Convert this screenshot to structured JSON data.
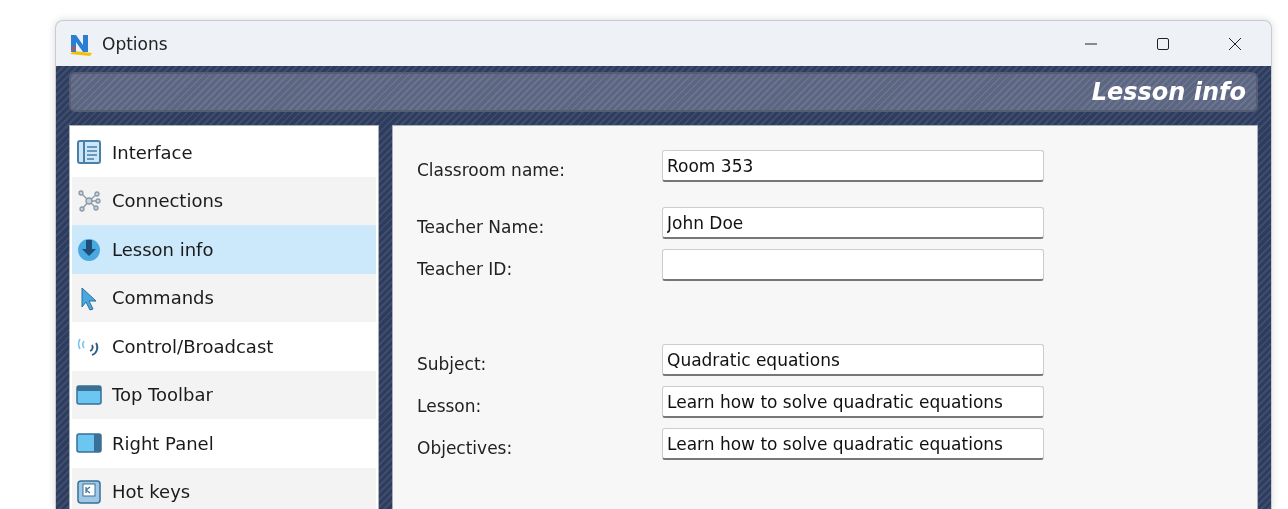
{
  "window": {
    "title": "Options"
  },
  "header": {
    "title": "Lesson info"
  },
  "sidebar": {
    "items": [
      {
        "label": "Interface",
        "kind": "interface",
        "selected": false
      },
      {
        "label": "Connections",
        "kind": "connections",
        "selected": false
      },
      {
        "label": "Lesson info",
        "kind": "lesson",
        "selected": true
      },
      {
        "label": "Commands",
        "kind": "commands",
        "selected": false
      },
      {
        "label": "Control/Broadcast",
        "kind": "broadcast",
        "selected": false
      },
      {
        "label": "Top Toolbar",
        "kind": "toolbar",
        "selected": false
      },
      {
        "label": "Right Panel",
        "kind": "panel",
        "selected": false
      },
      {
        "label": "Hot keys",
        "kind": "hotkeys",
        "selected": false
      }
    ]
  },
  "form": {
    "groups": [
      [
        {
          "label": "Classroom name:",
          "value": "Room 353"
        }
      ],
      [
        {
          "label": "Teacher Name:",
          "value": "John Doe"
        },
        {
          "label": "Teacher ID:"
        }
      ],
      [
        {
          "label": "Subject:",
          "value": "Quadratic equations"
        },
        {
          "label": "Lesson:",
          "value": "Learn how to solve quadratic equations"
        },
        {
          "label": "Objectives:",
          "value": "Learn how to solve quadratic equations"
        }
      ]
    ]
  }
}
